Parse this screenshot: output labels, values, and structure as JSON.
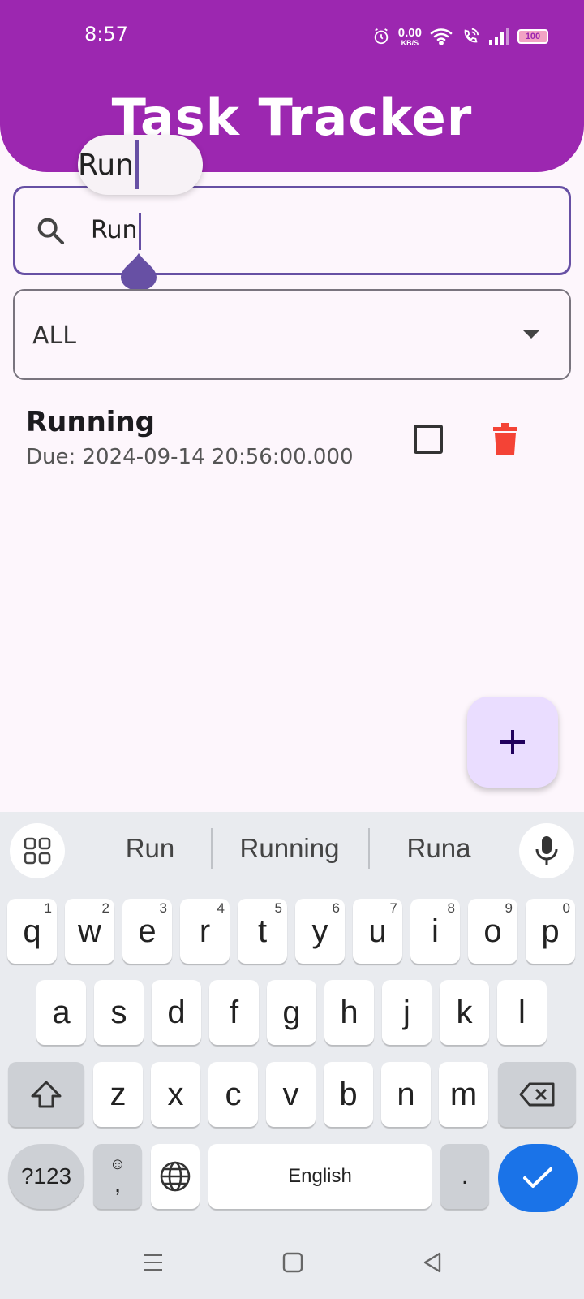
{
  "status_bar": {
    "time": "8:57",
    "net_speed_value": "0.00",
    "net_speed_unit": "KB/S",
    "battery": "100"
  },
  "app": {
    "title": "Task Tracker",
    "header_color": "#9c27b0"
  },
  "search": {
    "value": "Run",
    "magnifier_text": "Run",
    "icon": "search-icon"
  },
  "filter": {
    "selected": "ALL"
  },
  "tasks": [
    {
      "title": "Running",
      "due": "Due: 2024-09-14 20:56:00.000",
      "checked": false,
      "delete_color": "#f44336"
    }
  ],
  "fab": {
    "icon": "plus-icon",
    "color": "#eaddff"
  },
  "keyboard": {
    "suggestions": [
      "Run",
      "Running",
      "Runa"
    ],
    "row1": [
      {
        "k": "q",
        "h": "1"
      },
      {
        "k": "w",
        "h": "2"
      },
      {
        "k": "e",
        "h": "3"
      },
      {
        "k": "r",
        "h": "4"
      },
      {
        "k": "t",
        "h": "5"
      },
      {
        "k": "y",
        "h": "6"
      },
      {
        "k": "u",
        "h": "7"
      },
      {
        "k": "i",
        "h": "8"
      },
      {
        "k": "o",
        "h": "9"
      },
      {
        "k": "p",
        "h": "0"
      }
    ],
    "row2": [
      "a",
      "s",
      "d",
      "f",
      "g",
      "h",
      "j",
      "k",
      "l"
    ],
    "row3": [
      "z",
      "x",
      "c",
      "v",
      "b",
      "n",
      "m"
    ],
    "symbols_label": "?123",
    "comma_label": ",",
    "space_label": "English",
    "period_label": ".",
    "enter_color": "#1a73e8"
  }
}
